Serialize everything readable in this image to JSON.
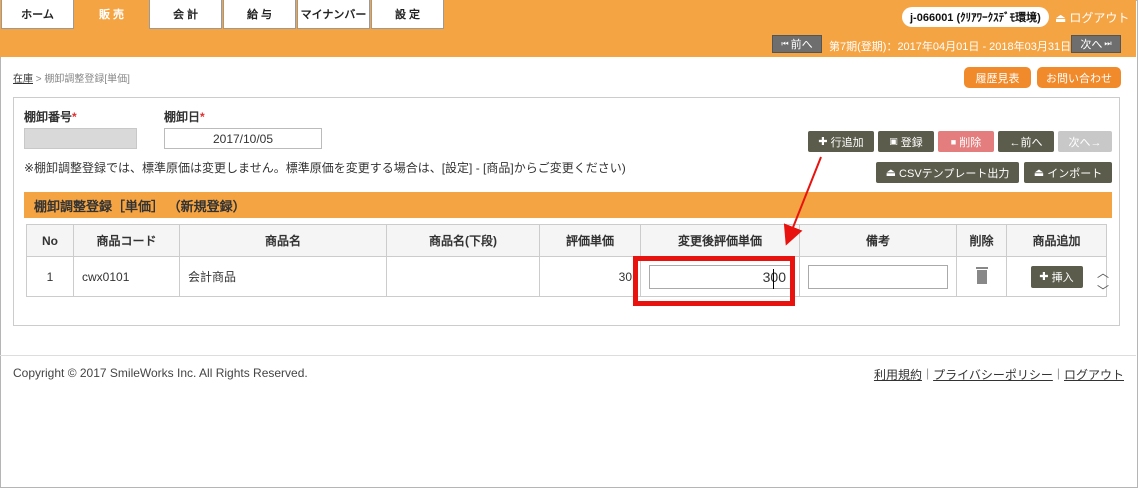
{
  "nav": {
    "tabs": [
      "ホーム",
      "販 売",
      "会 計",
      "給 与",
      "マイナンバー",
      "設 定"
    ],
    "active_tab": "販 売",
    "account": "j-066001 (ｸﾘｱﾜｰｸｽﾃﾞﾓ環境)",
    "logout": "ログアウト"
  },
  "period": {
    "prev_label": "前へ",
    "text": "第7期(登期)：2017年04月01日 - 2018年03月31日",
    "next_label": "次へ"
  },
  "breadcrumb": {
    "parent": "在庫",
    "separator": ">",
    "current": "棚卸調整登録[単価]"
  },
  "header_buttons": {
    "history": "履歴見表",
    "contact": "お問い合わせ"
  },
  "form": {
    "number_label": "棚卸番号",
    "date_label": "棚卸日",
    "required_mark": "*",
    "number_value": "",
    "date_value": "2017/10/05",
    "note": "※棚卸調整登録では、標準原価は変更しません。標準原価を変更する場合は、[設定] - [商品]からご変更ください)"
  },
  "toolbar": {
    "add_row": "行追加",
    "save": "登録",
    "delete": "削除",
    "prev": "←前へ",
    "next": "次へ→",
    "csv_template": "CSVテンプレート出力",
    "import": "インポート"
  },
  "section_title": "棚卸調整登録［単価］ （新規登録）",
  "table": {
    "headers": [
      "No",
      "商品コード",
      "商品名",
      "商品名(下段)",
      "評価単価",
      "変更後評価単価",
      "備考",
      "削除",
      "商品追加"
    ],
    "rows": [
      {
        "no": "1",
        "code": "cwx0101",
        "name": "会計商品",
        "name2": "",
        "unit_price": "30",
        "new_price": "300",
        "memo": "",
        "insert_label": "挿入"
      }
    ]
  },
  "footer": {
    "copyright": "Copyright © 2017 SmileWorks Inc. All Rights Reserved.",
    "links": [
      "利用規約",
      "プライバシーポリシー",
      "ログアウト"
    ]
  },
  "colors": {
    "accent": "#f5a443",
    "annotation": "#e8130e",
    "button_dark": "#5c5c4c"
  }
}
